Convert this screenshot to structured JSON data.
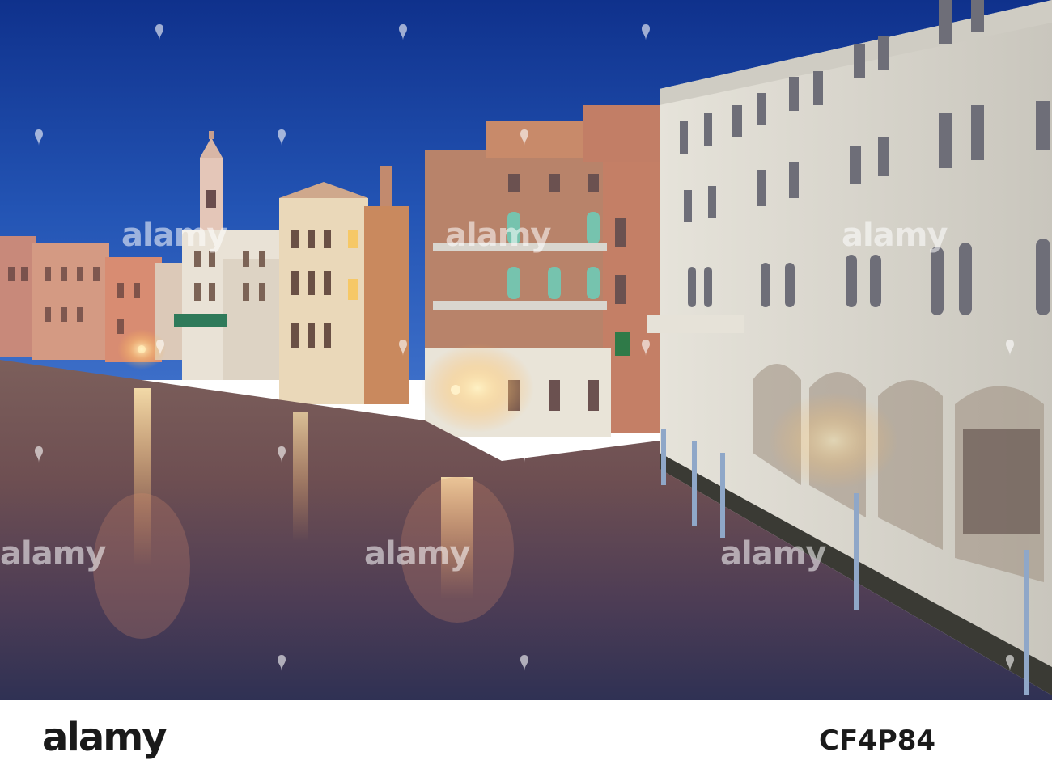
{
  "photo": {
    "scene": "grand-canal-venice-at-dusk",
    "colors": {
      "sky_top": "#123a9a",
      "sky_bottom": "#2b61c2",
      "water_warm": "#8a5a4a",
      "water_cool": "#3d3e63",
      "lamp_glow": "#ffd890",
      "stone_facade": "#d7d5cd",
      "brick_facade": "#b98368"
    }
  },
  "watermark": {
    "text": "alamy"
  },
  "footer": {
    "logo": "alamy",
    "image_id": "CF4P84"
  }
}
